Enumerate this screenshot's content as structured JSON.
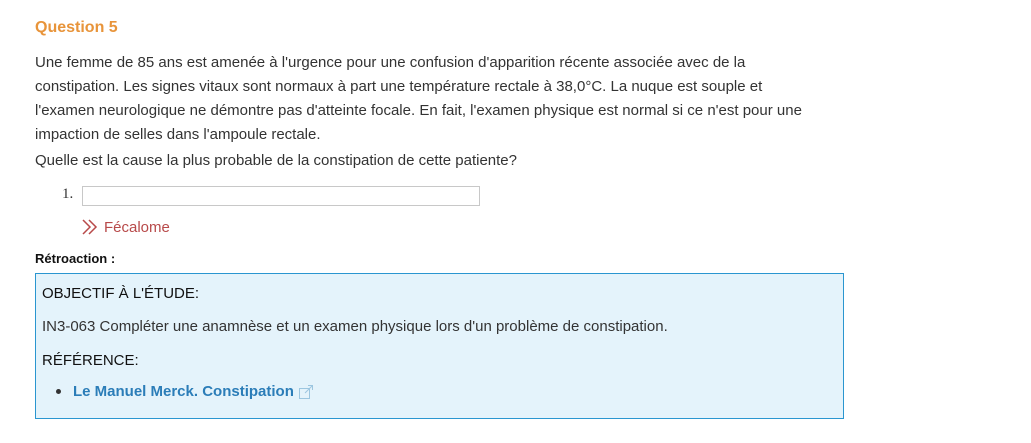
{
  "question": {
    "title": "Question 5",
    "body": "Une femme de 85 ans est amenée à l'urgence pour une confusion d'apparition récente associée avec de la constipation. Les signes vitaux sont normaux à part une température rectale à 38,0°C. La nuque est souple et l'examen neurologique ne démontre pas d'atteinte focale. En fait, l'examen physique est normal si ce n'est pour une impaction de selles dans l'ampoule rectale.",
    "prompt": "Quelle est la cause la plus probable de la constipation de cette patiente?"
  },
  "answer": {
    "number": "1.",
    "value": "",
    "correct_answer": "Fécalome"
  },
  "feedback": {
    "label": "Rétroaction :",
    "objective_heading": "OBJECTIF À L'ÉTUDE:",
    "objective_text": "IN3-063 Compléter une anamnèse et un examen physique lors d'un problème de constipation.",
    "reference_heading": "RÉFÉRENCE:",
    "references": [
      {
        "label": "Le Manuel Merck. Constipation",
        "icon": "external-link-icon"
      }
    ]
  },
  "colors": {
    "question_title": "#e8943a",
    "correct_answer": "#b84a4a",
    "feedback_border": "#2a96d0",
    "feedback_bg": "#e4f3fb",
    "link": "#2b7db8"
  }
}
